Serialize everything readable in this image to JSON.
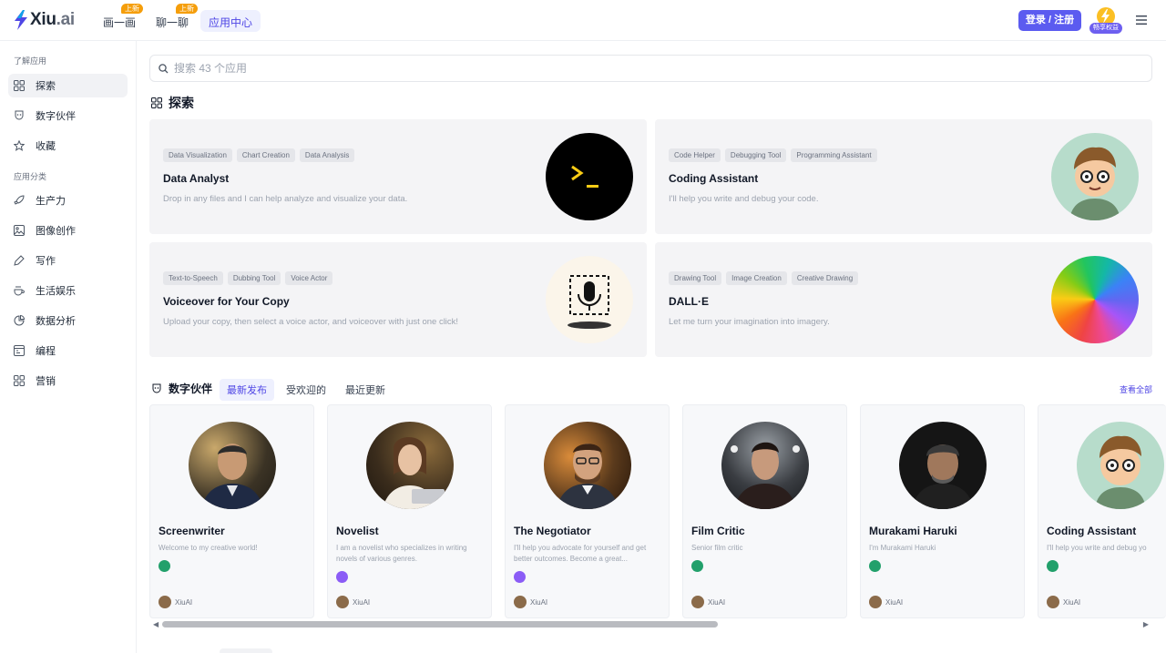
{
  "brand": {
    "name": "Xiu",
    "domain": ".ai",
    "accent": "#5b5bf0"
  },
  "nav": [
    {
      "label": "画一画",
      "badge": "上新"
    },
    {
      "label": "聊一聊",
      "badge": "上新"
    },
    {
      "label": "应用中心"
    }
  ],
  "header": {
    "login_label": "登录 / 注册",
    "vip_label": "畅享权益"
  },
  "sidebar": {
    "section1": "了解应用",
    "items1": [
      {
        "label": "探索",
        "icon": "grid-icon"
      },
      {
        "label": "数字伙伴",
        "icon": "mask-icon"
      },
      {
        "label": "收藏",
        "icon": "star-icon"
      }
    ],
    "section2": "应用分类",
    "items2": [
      {
        "label": "生产力",
        "icon": "rocket-icon"
      },
      {
        "label": "图像创作",
        "icon": "image-icon"
      },
      {
        "label": "写作",
        "icon": "pen-icon"
      },
      {
        "label": "生活娱乐",
        "icon": "coffee-icon"
      },
      {
        "label": "数据分析",
        "icon": "pie-icon"
      },
      {
        "label": "编程",
        "icon": "code-icon"
      },
      {
        "label": "营销",
        "icon": "apps-icon"
      }
    ]
  },
  "search": {
    "placeholder": "搜索 43 个应用"
  },
  "explore": {
    "title": "探索",
    "apps": [
      {
        "tags": [
          "Data Visualization",
          "Chart Creation",
          "Data Analysis"
        ],
        "title": "Data Analyst",
        "desc": "Drop in any files and I can help analyze and visualize your data.",
        "thumb": "terminal"
      },
      {
        "tags": [
          "Code Helper",
          "Debugging Tool",
          "Programming Assistant"
        ],
        "title": "Coding Assistant",
        "desc": "I'll help you write and debug your code.",
        "thumb": "cartoon"
      },
      {
        "tags": [
          "Text-to-Speech",
          "Dubbing Tool",
          "Voice Actor"
        ],
        "title": "Voiceover for Your Copy",
        "desc": "Upload your copy, then select a voice actor, and voiceover with just one click!",
        "thumb": "mic"
      },
      {
        "tags": [
          "Drawing Tool",
          "Image Creation",
          "Creative Drawing"
        ],
        "title": "DALL·E",
        "desc": "Let me turn your imagination into imagery.",
        "thumb": "color-wheel"
      }
    ]
  },
  "partners": {
    "title": "数字伙伴",
    "tabs": [
      "最新发布",
      "受欢迎的",
      "最近更新"
    ],
    "see_all": "查看全部",
    "cards": [
      {
        "name": "Screenwriter",
        "desc": "Welcome to my creative world!",
        "model": "green",
        "author": "XiuAI"
      },
      {
        "name": "Novelist",
        "desc": "I am a novelist who specializes in writing novels of various genres.",
        "model": "purple",
        "author": "XiuAI"
      },
      {
        "name": "The Negotiator",
        "desc": "I'll help you advocate for yourself and get better outcomes. Become a great...",
        "model": "purple",
        "author": "XiuAI"
      },
      {
        "name": "Film Critic",
        "desc": "Senior film critic",
        "model": "green",
        "author": "XiuAI"
      },
      {
        "name": "Murakami Haruki",
        "desc": "I'm Murakami Haruki",
        "model": "green",
        "author": "XiuAI"
      },
      {
        "name": "Coding Assistant",
        "desc": "I'll help you write and debug yo",
        "model": "green",
        "author": "XiuAI"
      }
    ]
  },
  "colors": {
    "model_green": "#22a06b",
    "model_purple": "#8b5cf6"
  }
}
